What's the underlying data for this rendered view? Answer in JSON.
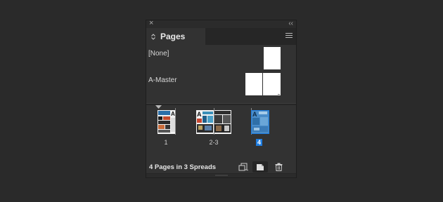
{
  "panel": {
    "title": "Pages",
    "close_glyph": "×",
    "collapse_glyph": "‹‹",
    "tab_arrows_glyph": "⌃⌄",
    "icons": {
      "close": "close-icon",
      "collapse": "collapse-panel-icon",
      "tab_arrows": "updown-arrows-icon",
      "menu": "panel-menu-icon"
    }
  },
  "masters": [
    {
      "label": "[None]"
    },
    {
      "label": "A-Master"
    }
  ],
  "pages": [
    {
      "label": "1",
      "selected": false
    },
    {
      "label": "2-3",
      "selected": false
    },
    {
      "label": "4",
      "selected": true
    }
  ],
  "status": {
    "text": "4 Pages in 3 Spreads"
  },
  "buttons": {
    "edit_page_size": "edit-page-size-icon",
    "new_page": "new-page-icon",
    "delete": "trash-icon"
  },
  "colors": {
    "background": "#2a2a2a",
    "panel": "#323232",
    "selection": "#1f7de0"
  }
}
